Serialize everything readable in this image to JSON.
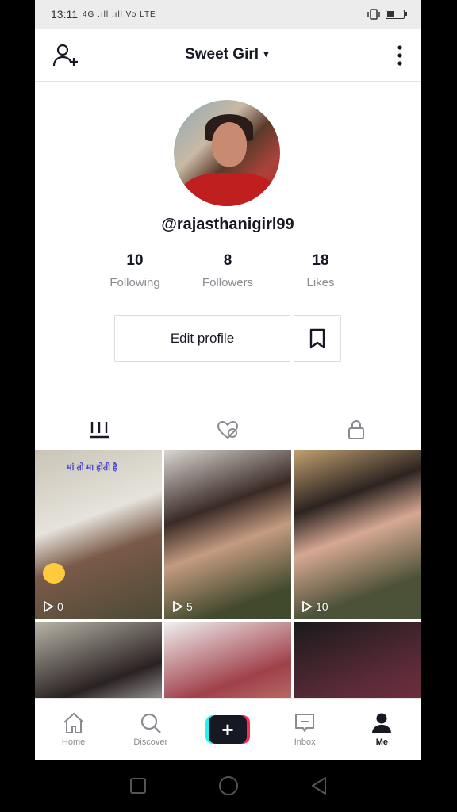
{
  "status": {
    "time": "13:11",
    "signal_text": "4G .ıll .ıll Vo LTE"
  },
  "header": {
    "title": "Sweet Girl"
  },
  "profile": {
    "username": "@rajasthanigirl99"
  },
  "stats": [
    {
      "value": "10",
      "label": "Following"
    },
    {
      "value": "8",
      "label": "Followers"
    },
    {
      "value": "18",
      "label": "Likes"
    }
  ],
  "actions": {
    "edit_label": "Edit profile"
  },
  "videos": [
    {
      "views": "0",
      "caption": "मां तो मा होती है"
    },
    {
      "views": "5"
    },
    {
      "views": "10"
    },
    {
      "views": ""
    },
    {
      "views": ""
    },
    {
      "views": ""
    }
  ],
  "nav": {
    "home": "Home",
    "discover": "Discover",
    "inbox": "Inbox",
    "me": "Me"
  }
}
